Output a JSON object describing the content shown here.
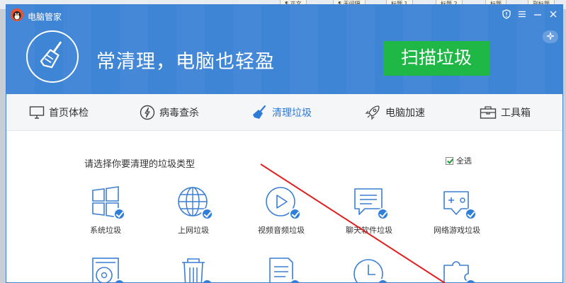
{
  "window": {
    "title": "电脑管家"
  },
  "header": {
    "slogan": "常清理，电脑也轻盈",
    "scan_button": "扫描垃圾",
    "controls": [
      "shield-icon",
      "menu-icon",
      "minimize-icon",
      "close-icon"
    ]
  },
  "nav": {
    "items": [
      {
        "label": "首页体检",
        "icon": "monitor-icon",
        "active": false
      },
      {
        "label": "病毒查杀",
        "icon": "lightning-icon",
        "active": false
      },
      {
        "label": "清理垃圾",
        "icon": "broom-icon",
        "active": true
      },
      {
        "label": "电脑加速",
        "icon": "rocket-icon",
        "active": false
      },
      {
        "label": "工具箱",
        "icon": "toolbox-icon",
        "active": false
      }
    ]
  },
  "content": {
    "prompt": "请选择你要清理的垃圾类型",
    "select_all": "全选",
    "categories": [
      {
        "label": "系统垃圾",
        "icon": "windows-icon"
      },
      {
        "label": "上网垃圾",
        "icon": "globe-icon"
      },
      {
        "label": "视频音频垃圾",
        "icon": "play-icon"
      },
      {
        "label": "聊天软件垃圾",
        "icon": "chat-icon"
      },
      {
        "label": "网络游戏垃圾",
        "icon": "gamepad-icon"
      },
      {
        "label": "",
        "icon": "disc-icon"
      },
      {
        "label": "",
        "icon": "trash-icon"
      },
      {
        "label": "",
        "icon": "document-icon"
      },
      {
        "label": "",
        "icon": "clock-icon"
      },
      {
        "label": "",
        "icon": "puzzle-icon"
      }
    ]
  },
  "background_tabs": [
    "¶ 正文",
    "¶ 无间隔",
    "标题 1",
    "标题 2",
    "标题",
    "副标题"
  ],
  "colors": {
    "header_blue": "#3f85d6",
    "scan_green": "#1fb745",
    "accent_blue": "#2d7ad7",
    "annotation_red": "#e02020"
  }
}
